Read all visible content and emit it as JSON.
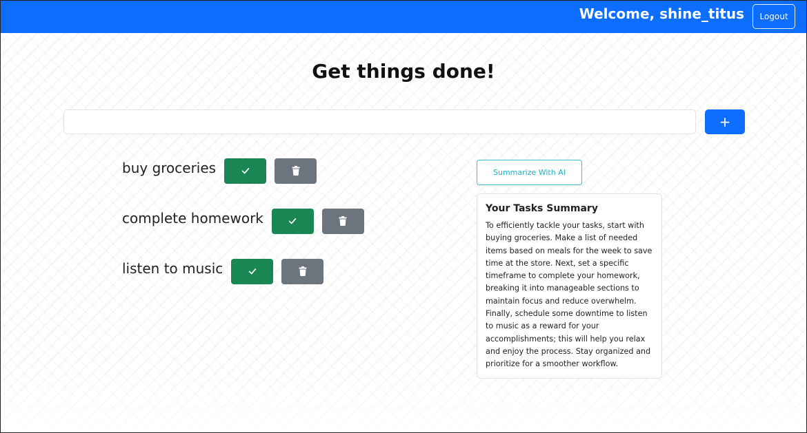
{
  "header": {
    "welcome_text": "Welcome, shine_titus",
    "logout_label": "Logout",
    "bg_color": "#0d6efd"
  },
  "main": {
    "title": "Get things done!",
    "input_value": "",
    "add_label": "+"
  },
  "tasks": [
    {
      "label": "buy groceries",
      "done_icon": "check-icon",
      "delete_icon": "trash-icon"
    },
    {
      "label": "complete homework",
      "done_icon": "check-icon",
      "delete_icon": "trash-icon"
    },
    {
      "label": "listen to music",
      "done_icon": "check-icon",
      "delete_icon": "trash-icon"
    }
  ],
  "summary": {
    "button_label": "Summarize With AI",
    "title": "Your Tasks Summary",
    "text": "To efficiently tackle your tasks, start with buying groceries. Make a list of needed items based on meals for the week to save time at the store. Next, set a specific timeframe to complete your homework, breaking it into manageable sections to maintain focus and reduce overwhelm. Finally, schedule some downtime to listen to music as a reward for your accomplishments; this will help you relax and enjoy the process. Stay organized and prioritize for a smoother workflow."
  },
  "colors": {
    "primary": "#0d6efd",
    "success": "#198754",
    "secondary": "#6c757d",
    "info": "#20b0c8"
  }
}
